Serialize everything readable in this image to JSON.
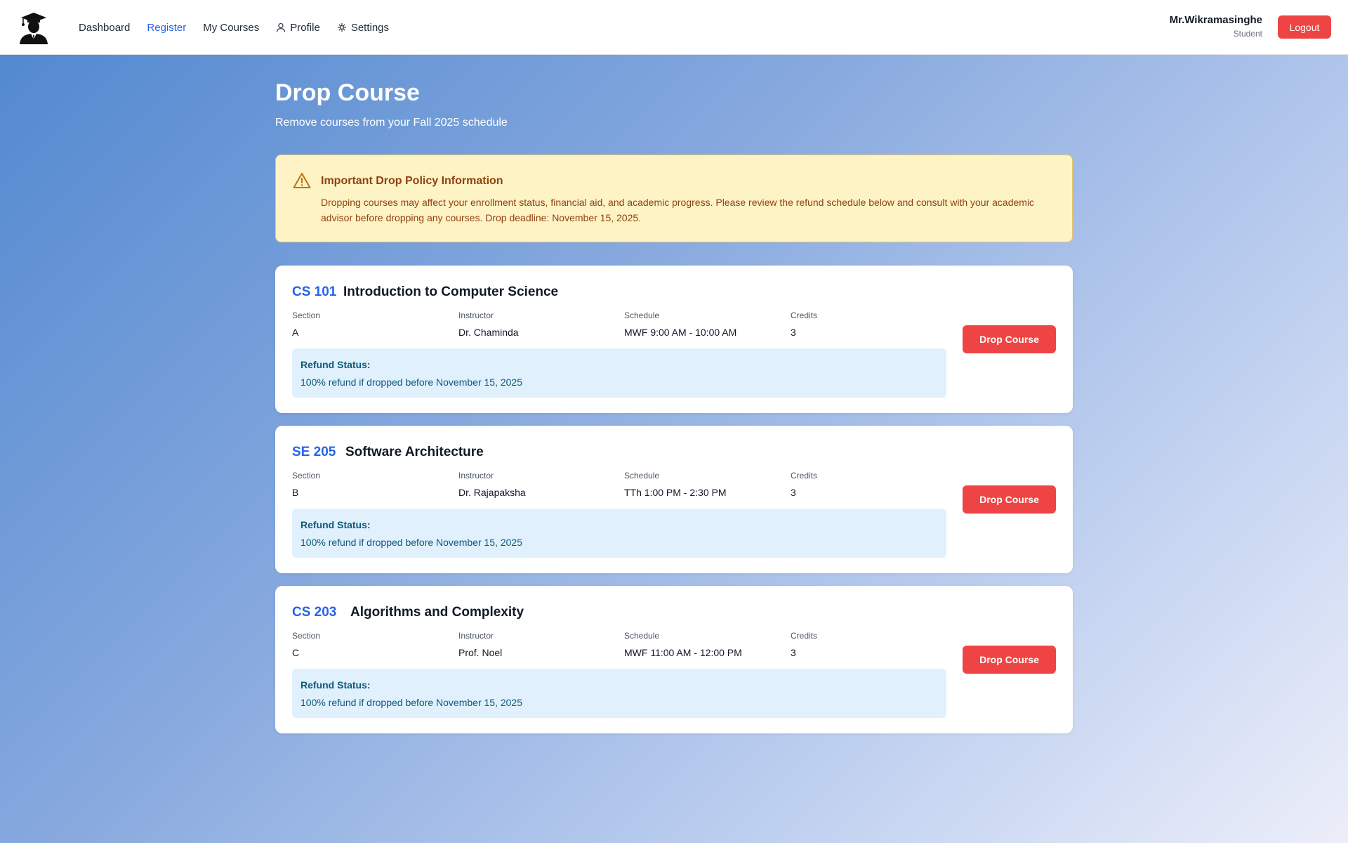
{
  "nav": {
    "items": [
      {
        "label": "Dashboard",
        "icon": ""
      },
      {
        "label": "Register",
        "icon": "",
        "active": true
      },
      {
        "label": "My Courses",
        "icon": ""
      },
      {
        "label": "Profile",
        "icon": "user-icon"
      },
      {
        "label": "Settings",
        "icon": "settings-icon"
      }
    ],
    "active_color": "#2563eb"
  },
  "user": {
    "name": "Mr.Wikramasinghe",
    "role": "Student",
    "logout_label": "Logout"
  },
  "header": {
    "title": "Drop Course",
    "subtitle": "Remove courses from your Fall 2025 schedule"
  },
  "alert": {
    "icon": "warning-icon",
    "title": "Important Drop Policy Information",
    "text": "Dropping courses may affect your enrollment status, financial aid, and academic progress. Please review the refund schedule below and consult with your academic advisor before dropping any courses. Drop deadline: November 15, 2025."
  },
  "field_labels": {
    "section": "Section",
    "instructor": "Instructor",
    "schedule": "Schedule",
    "credits": "Credits",
    "refund_status": "Refund Status:"
  },
  "drop_label": "Drop Course",
  "courses": [
    {
      "code": "CS 101",
      "name": "Introduction to Computer Science",
      "section": "A",
      "instructor": "Dr. Chaminda",
      "schedule": "MWF 9:00 AM - 10:00 AM",
      "credits": "3",
      "refund": "100% refund if dropped before November 15, 2025"
    },
    {
      "code": "SE 205",
      "name": "Software Architecture",
      "section": "B",
      "instructor": "Dr. Rajapaksha",
      "schedule": "TTh 1:00 PM - 2:30 PM",
      "credits": "3",
      "refund": "100% refund if dropped before November 15, 2025"
    },
    {
      "code": "CS 203",
      "name": "Algorithms and Complexity",
      "section": "C",
      "instructor": "Prof. Noel",
      "schedule": "MWF 11:00 AM - 12:00 PM",
      "credits": "3",
      "refund": "100% refund if dropped before November 15, 2025"
    }
  ],
  "colors": {
    "accent": "#2563eb",
    "danger": "#ef4444",
    "alert_bg": "#fdf3c5",
    "alert_text": "#92400e",
    "refund_bg": "#e0f0fc",
    "refund_text": "#0c5a7a"
  }
}
